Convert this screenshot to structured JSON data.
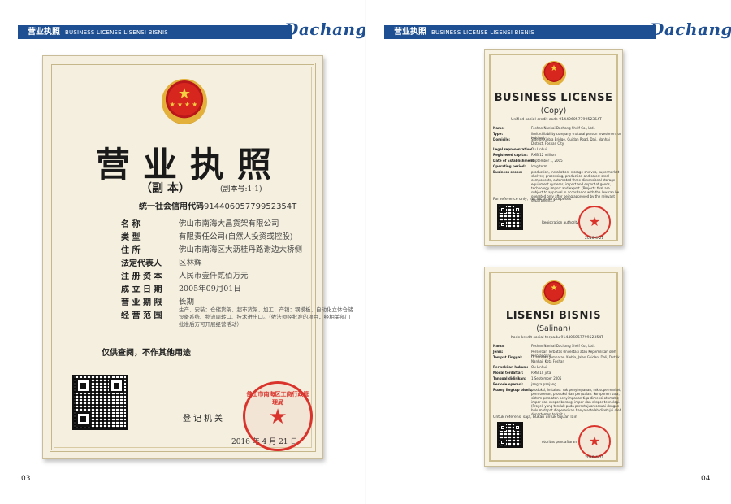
{
  "left_page": {
    "header": {
      "title": "营业执照",
      "subtitle": "BUSINESS LICENSE LISENSI BISNIS"
    },
    "brand": "Dachang",
    "page_number": "03",
    "certificate": {
      "title": "营业执照",
      "copy": "（副  本）",
      "copy_no": "(副本号:1-1)",
      "credit_label": "统一社会信用代码",
      "credit_code": "91440605779952354T",
      "fields": [
        {
          "label": "名        称",
          "value": "佛山市南海大昌货架有限公司"
        },
        {
          "label": "类        型",
          "value": "有限责任公司(自然人投资或控股)"
        },
        {
          "label": "住        所",
          "value": "佛山市南海区大沥桂丹路谢边大桥侧"
        },
        {
          "label": "法定代表人",
          "value": "区林辉"
        },
        {
          "label": "注 册 资 本",
          "value": "人民币壹仟贰佰万元"
        },
        {
          "label": "成 立 日 期",
          "value": "2005年09月01日"
        },
        {
          "label": "营 业 期 限",
          "value": "长期"
        },
        {
          "label": "经 营 范 围",
          "value": "生产、安装：仓储货架、超市货架、加工、产销：钢模板、自动化立体仓储设备系统、物流周转口、技术进出口。（依法须经批准的项目，经相关部门批准后方可开展经营活动）"
        }
      ],
      "note": "仅供查阅，不作其他用途",
      "authority": "登记机关",
      "date": "2016 年 4 月 21 日",
      "seal_text": "佛山市南海区工商行政管理局"
    }
  },
  "right_page": {
    "header": {
      "title": "营业执照",
      "subtitle": "BUSINESS LICENSE LISENSI BISNIS"
    },
    "brand": "Dachang",
    "page_number": "04",
    "english_license": {
      "title": "BUSINESS LICENSE",
      "copy": "(Copy)",
      "credit_line": "Unified social credit code 91440605779952354T",
      "rows": [
        {
          "label": "Name:",
          "value": "Foshan Nanhai Dachang Shelf Co., Ltd."
        },
        {
          "label": "Type:",
          "value": "limited liability company (natural person investment or holding)"
        },
        {
          "label": "Domicile:",
          "value": "Side of Xiebia Bridge, Guidan Road, Dali, Nanhai District, Foshan City"
        },
        {
          "label": "Legal representative:",
          "value": "Ou Linhui"
        },
        {
          "label": "Registered capital:",
          "value": "RMB 12 million"
        },
        {
          "label": "Date of Establishment:",
          "value": "September 1, 2005"
        },
        {
          "label": "Operating period:",
          "value": "long-term"
        },
        {
          "label": "Business scope:",
          "value": "production, installation: storage shelves, supermarket shelves; processing, production and sales: steel components, automated three-dimensional storage equipment systems; import and export of goods, technology import and export. (Projects that are subject to approval in accordance with the law can be operated only after being approved by the relevant departments.)"
        }
      ],
      "note": "For reference only, not for other purposes",
      "authority": "Registration authority",
      "date": "2016-4-21"
    },
    "indonesian_license": {
      "title": "LISENSI BISNIS",
      "copy": "(Salinan)",
      "credit_line": "Kode kredit sosial terpadu 91440605779952354T",
      "rows": [
        {
          "label": "Nama:",
          "value": "Foshan Nanhai Dachang Shelf Co., Ltd."
        },
        {
          "label": "Jenis:",
          "value": "Perseroan Terbatas (Investasi atau Kepemilikan oleh Perorangan)"
        },
        {
          "label": "Tempat Tinggal:",
          "value": "Di sebelah Jembatan Xiebia, Jalan Guidan, Dali, Distrik Nanhai, Kota Foshan"
        },
        {
          "label": "Perwakilan hukum:",
          "value": "Ou Linhui"
        },
        {
          "label": "Modal terdaftar:",
          "value": "RMB 10 juta"
        },
        {
          "label": "Tanggal didirikan:",
          "value": "1 September 2005"
        },
        {
          "label": "Periode operasi:",
          "value": "jangka panjang"
        },
        {
          "label": "Ruang lingkup bisnis:",
          "value": "produksi, instalasi: rak penyimpanan, rak supermarket; pemrosesan, produksi dan penjualan: komponen baja, sistem peralatan penyimpanan tiga dimensi otomatis; impor dan ekspor barang, impor dan ekspor teknologi. (Proyek yang tunduk pada persetujuan sesuai dengan hukum dapat dioperasikan hanya setelah disetujui oleh departemen terkait.)"
        }
      ],
      "note": "Untuk referensi saja, bukan untuk tujuan lain",
      "authority": "otoritas pendaftaran",
      "date": "2016-4-21"
    }
  },
  "colors": {
    "header_band": "#1d4f92",
    "seal_red": "#d9332c",
    "paper": "#f4efde"
  }
}
